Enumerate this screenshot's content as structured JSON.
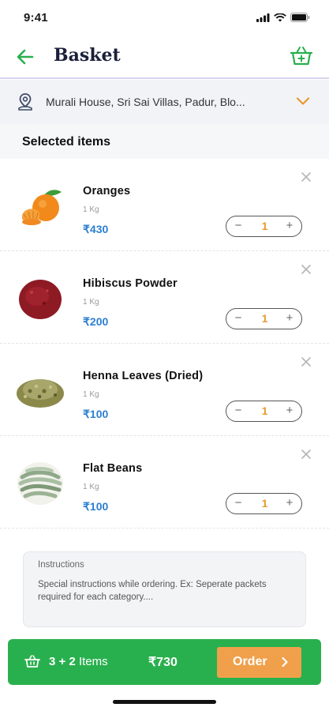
{
  "status_bar": {
    "time": "9:41"
  },
  "header": {
    "title": "Basket"
  },
  "address": {
    "text": "Murali House, Sri Sai Villas, Padur, Blo..."
  },
  "section": {
    "title": "Selected items"
  },
  "items": [
    {
      "name": "Oranges",
      "unit": "1 Kg",
      "price": "₹430",
      "qty": "1"
    },
    {
      "name": "Hibiscus Powder",
      "unit": "1 Kg",
      "price": "₹200",
      "qty": "1"
    },
    {
      "name": "Henna Leaves (Dried)",
      "unit": "1 Kg",
      "price": "₹100",
      "qty": "1"
    },
    {
      "name": "Flat Beans",
      "unit": "1 Kg",
      "price": "₹100",
      "qty": "1"
    }
  ],
  "stepper": {
    "minus": "−",
    "plus": "+"
  },
  "instructions": {
    "label": "Instructions",
    "placeholder": "Special instructions while ordering. Ex: Seperate packets required for each category...."
  },
  "order_bar": {
    "count_bold": "3 + 2",
    "count_suffix": "Items",
    "total": "₹730",
    "order_label": "Order"
  },
  "colors": {
    "accent_green": "#29b04e",
    "order_orange": "#f0a04b",
    "price_blue": "#2c7fd1",
    "qty_orange": "#e79a2d"
  },
  "icons": [
    "back-arrow-icon",
    "basket-add-icon",
    "location-pin-icon",
    "chevron-down-icon",
    "close-icon",
    "cart-icon",
    "chevron-right-icon"
  ]
}
